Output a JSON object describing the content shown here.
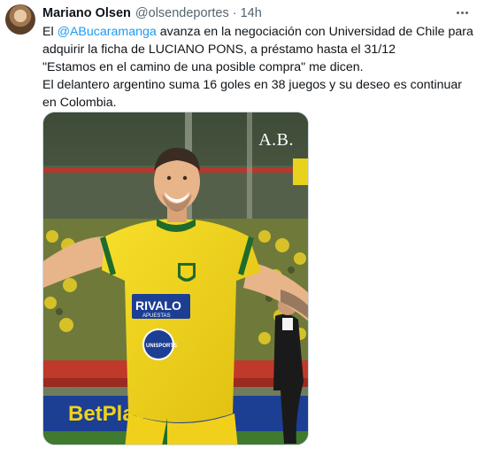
{
  "author": {
    "name": "Mariano Olsen",
    "handle": "@olsendeportes",
    "separator": "·",
    "time": "14h"
  },
  "tweet": {
    "line1_pre": "El ",
    "mention": "@ABucaramanga",
    "line1_post": " avanza en la negociación con Universidad de Chile para",
    "line2": "adquirir la ficha de LUCIANO PONS, a préstamo hasta el 31/12",
    "line3": "\"Estamos en el camino de una posible compra\" me dicen.",
    "line4": "El delantero argentino suma 16 goles en 38 juegos y su deseo es continuar",
    "line5": "en Colombia."
  },
  "media": {
    "brand_mark": "A.B.",
    "jersey_sponsor": "RIVALO",
    "jersey_sponsor_sub": "APUESTAS",
    "jersey_badge": "UNISPORTS",
    "ad_board": "BetPlay",
    "colors": {
      "jersey": "#f2d21a",
      "jersey_accent": "#1f6b2b",
      "stand_seats": "#c0392b",
      "board": "#1c3e93"
    }
  }
}
